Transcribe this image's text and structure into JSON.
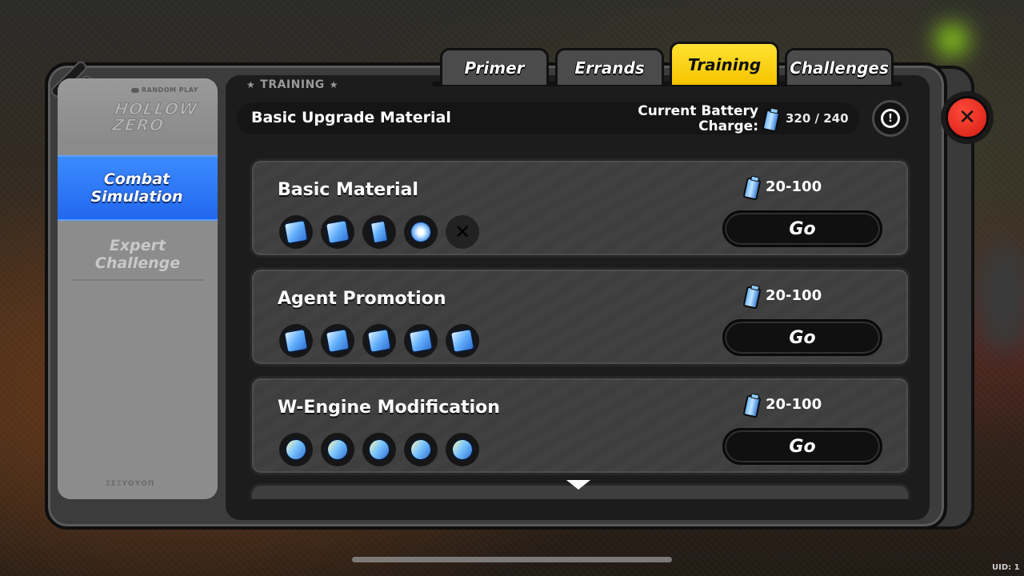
{
  "tabs": [
    {
      "label": "Primer",
      "active": false
    },
    {
      "label": "Errands",
      "active": false
    },
    {
      "label": "Training",
      "active": true
    },
    {
      "label": "Challenges",
      "active": false
    }
  ],
  "sidebar": {
    "badge": "RANDOM PLAY",
    "logo": "HOLLOW ZERO",
    "footer": "ΞΣΞΥΟΥΟΠ",
    "items": [
      {
        "label": "Combat Simulation",
        "active": true
      },
      {
        "label": "Expert Challenge",
        "active": false
      }
    ]
  },
  "section": {
    "label": "TRAINING"
  },
  "header": {
    "title": "Basic Upgrade Material",
    "battery_label": "Current Battery Charge:",
    "battery_value": "320 / 240"
  },
  "cards": [
    {
      "title": "Basic Material",
      "cost": "20-100",
      "button": "Go",
      "icons": [
        "chip-material-icon",
        "disk-material-icon",
        "canister-material-icon",
        "orb-material-icon",
        "locked-slot-icon"
      ]
    },
    {
      "title": "Agent Promotion",
      "cost": "20-100",
      "button": "Go",
      "icons": [
        "attack-chip-icon",
        "stun-chip-icon",
        "anomaly-chip-icon",
        "support-chip-icon",
        "defense-chip-icon"
      ]
    },
    {
      "title": "W-Engine Modification",
      "cost": "20-100",
      "button": "Go",
      "icons": [
        "attack-power-icon",
        "stun-power-icon",
        "anomaly-power-icon",
        "support-power-icon",
        "defense-power-icon"
      ]
    }
  ],
  "uid": "UID: 1",
  "colors": {
    "accent_yellow": "#f6c400",
    "active_blue": "#2f78f5",
    "close_red": "#e0271a"
  }
}
